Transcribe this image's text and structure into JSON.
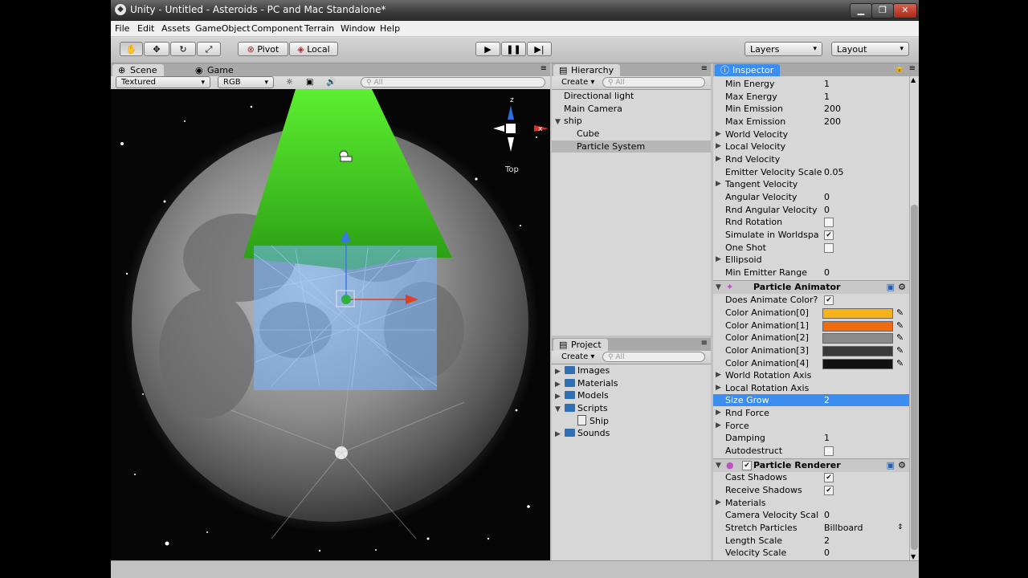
{
  "window": {
    "title": "Unity - Untitled - Asteroids - PC and Mac Standalone*"
  },
  "menu": [
    "File",
    "Edit",
    "Assets",
    "GameObject",
    "Component",
    "Terrain",
    "Window",
    "Help"
  ],
  "toolbar": {
    "pivot_label": "Pivot",
    "local_label": "Local",
    "layers_label": "Layers",
    "layout_label": "Layout"
  },
  "scene": {
    "tab_scene": "Scene",
    "tab_game": "Game",
    "render_mode": "Textured",
    "color_mode": "RGB",
    "search_placeholder": "All",
    "gizmo_view_label": "Top",
    "gizmo_axes": [
      "z",
      "x"
    ]
  },
  "hierarchy": {
    "tab": "Hierarchy",
    "create_label": "Create",
    "search_placeholder": "All",
    "items": [
      "Directional light",
      "Main Camera",
      "ship",
      "Cube",
      "Particle System"
    ]
  },
  "project": {
    "tab": "Project",
    "create_label": "Create",
    "search_placeholder": "All",
    "items": [
      "Images",
      "Materials",
      "Models",
      "Scripts",
      "Ship",
      "Sounds"
    ]
  },
  "inspector": {
    "tab": "Inspector",
    "emitter": {
      "min_energy_label": "Min Energy",
      "min_energy": "1",
      "max_energy_label": "Max Energy",
      "max_energy": "1",
      "min_emission_label": "Min Emission",
      "min_emission": "200",
      "max_emission_label": "Max Emission",
      "max_emission": "200",
      "world_velocity_label": "World Velocity",
      "local_velocity_label": "Local Velocity",
      "rnd_velocity_label": "Rnd Velocity",
      "emitter_velocity_scale_label": "Emitter Velocity Scale",
      "emitter_velocity_scale": "0.05",
      "tangent_velocity_label": "Tangent Velocity",
      "angular_velocity_label": "Angular Velocity",
      "angular_velocity": "0",
      "rnd_angular_velocity_label": "Rnd Angular Velocity",
      "rnd_angular_velocity": "0",
      "rnd_rotation_label": "Rnd Rotation",
      "simulate_worldspace_label": "Simulate in Worldspa",
      "one_shot_label": "One Shot",
      "ellipsoid_label": "Ellipsoid",
      "min_emitter_range_label": "Min Emitter Range",
      "min_emitter_range": "0"
    },
    "animator": {
      "title": "Particle Animator",
      "does_animate_color_label": "Does Animate Color?",
      "color_labels": [
        "Color Animation[0]",
        "Color Animation[1]",
        "Color Animation[2]",
        "Color Animation[3]",
        "Color Animation[4]"
      ],
      "colors": [
        "#f7b21a",
        "#f06a10",
        "#8a8a8a",
        "#3a3a3a",
        "#111111"
      ],
      "world_rotation_axis_label": "World Rotation Axis",
      "local_rotation_axis_label": "Local Rotation Axis",
      "size_grow_label": "Size Grow",
      "size_grow": "2",
      "rnd_force_label": "Rnd Force",
      "force_label": "Force",
      "damping_label": "Damping",
      "damping": "1",
      "autodestruct_label": "Autodestruct"
    },
    "renderer": {
      "title": "Particle Renderer",
      "cast_shadows_label": "Cast Shadows",
      "receive_shadows_label": "Receive Shadows",
      "materials_label": "Materials",
      "camera_velocity_scale_label": "Camera Velocity Scal",
      "camera_velocity_scale": "0",
      "stretch_particles_label": "Stretch Particles",
      "stretch_particles": "Billboard",
      "length_scale_label": "Length Scale",
      "length_scale": "2",
      "velocity_scale_label": "Velocity Scale",
      "velocity_scale": "0"
    }
  }
}
